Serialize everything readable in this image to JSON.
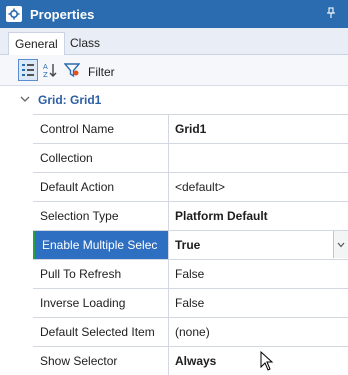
{
  "window": {
    "title": "Properties"
  },
  "tabs": [
    {
      "label": "General",
      "active": true
    },
    {
      "label": "Class",
      "active": false
    }
  ],
  "toolbar": {
    "filter_label": "Filter"
  },
  "grid": {
    "header": "Grid: Grid1",
    "rows": [
      {
        "name": "Control Name",
        "value": "Grid1",
        "bold": true
      },
      {
        "name": "Collection",
        "value": "",
        "bold": false
      },
      {
        "name": "Default Action",
        "value": "<default>",
        "bold": false
      },
      {
        "name": "Selection Type",
        "value": "Platform Default",
        "bold": true
      },
      {
        "name": "Enable Multiple Selec",
        "value": "True",
        "bold": true,
        "selected": true
      },
      {
        "name": "Pull To Refresh",
        "value": "False",
        "bold": false
      },
      {
        "name": "Inverse Loading",
        "value": "False",
        "bold": false
      },
      {
        "name": "Default Selected Item",
        "value": "(none)",
        "bold": false
      },
      {
        "name": "Show Selector",
        "value": "Always",
        "bold": true
      }
    ]
  },
  "colors": {
    "titlebar": "#2b6cb0",
    "selected_row": "#2e6fc2",
    "header_text": "#2c5fa5"
  }
}
